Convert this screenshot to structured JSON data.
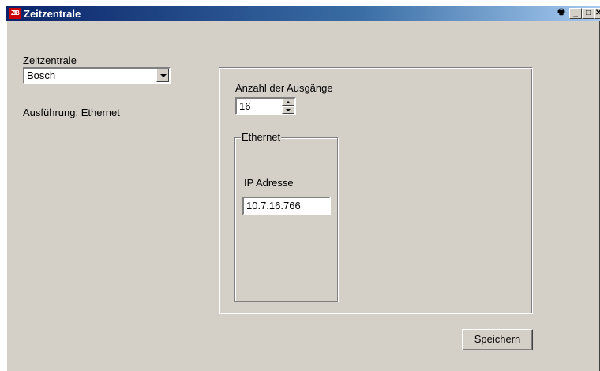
{
  "window": {
    "title": "Zeitzentrale",
    "icon_text": "ZIB"
  },
  "titlebar_buttons": {
    "print": "🖶",
    "minimize": "_",
    "maximize": "□",
    "close": "✕"
  },
  "left": {
    "zeitzentrale_label": "Zeitzentrale",
    "zeitzentrale_value": "Bosch",
    "ausfuehrung": "Ausführung: Ethernet"
  },
  "panel": {
    "outputs_label": "Anzahl der Ausgänge",
    "outputs_value": "16",
    "group_title": "Ethernet",
    "ip_label": "IP Adresse",
    "ip_value": "10.7.16.766"
  },
  "actions": {
    "save_label": "Speichern"
  }
}
